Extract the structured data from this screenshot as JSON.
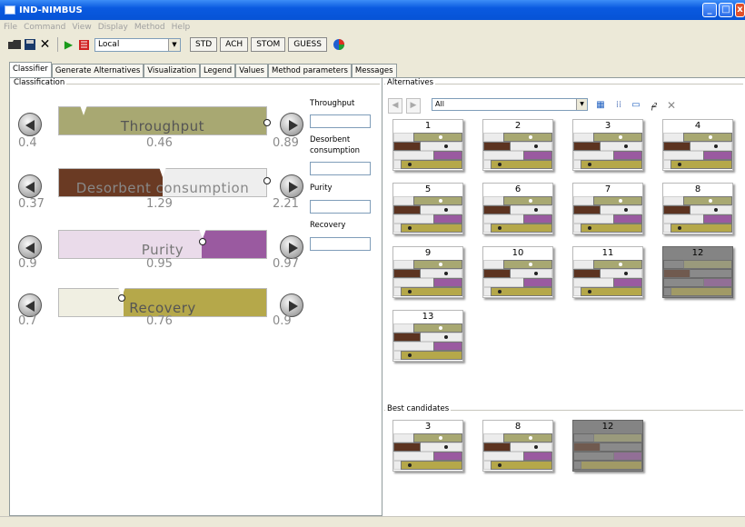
{
  "window": {
    "title": "IND-NIMBUS"
  },
  "menu": [
    "File",
    "Command",
    "View",
    "Display",
    "Method",
    "Help"
  ],
  "toolbar": {
    "method_select": "Local",
    "buttons": [
      "STD",
      "ACH",
      "STOM",
      "GUESS"
    ]
  },
  "tabs": [
    "Classifier",
    "Generate Alternatives",
    "Visualization",
    "Legend",
    "Values",
    "Method parameters",
    "Messages"
  ],
  "classification": {
    "title": "Classification",
    "objectives": [
      {
        "name": "Throughput",
        "min": "0.4",
        "current": "0.46",
        "max": "0.89",
        "input_label": "Throughput",
        "input_value": "",
        "color": "#a8a872",
        "fill_fraction": 1.0,
        "marker_fraction": 0.12
      },
      {
        "name": "Desorbent consumption",
        "min": "0.37",
        "current": "1.29",
        "max": "2.21",
        "input_label": "Desorbent consumption",
        "input_value": "",
        "color": "#6a3a23",
        "fill_fraction": 0.5,
        "marker_fraction": 0.5
      },
      {
        "name": "Purity",
        "min": "0.9",
        "current": "0.95",
        "max": "0.97",
        "input_label": "Purity",
        "input_value": "",
        "color": "#9a5aa0",
        "fill_fraction": 0.31,
        "marker_fraction": 0.69
      },
      {
        "name": "Recovery",
        "min": "0.7",
        "current": "0.76",
        "max": "0.9",
        "input_label": "Recovery",
        "input_value": "",
        "color": "#b5a84a",
        "fill_fraction": 0.69,
        "marker_fraction": 0.31
      }
    ]
  },
  "alternatives": {
    "title": "Alternatives",
    "filter": "All",
    "items": [
      "1",
      "2",
      "3",
      "4",
      "5",
      "6",
      "7",
      "8",
      "9",
      "10",
      "11",
      "12",
      "13"
    ],
    "selected": "12"
  },
  "best": {
    "title": "Best candidates",
    "items": [
      "3",
      "8",
      "12"
    ],
    "selected": "12"
  },
  "colors": {
    "throughput": "#a8a872",
    "desorbent": "#5c3320",
    "purity": "#9a5aa0",
    "recovery": "#b5a84a"
  }
}
